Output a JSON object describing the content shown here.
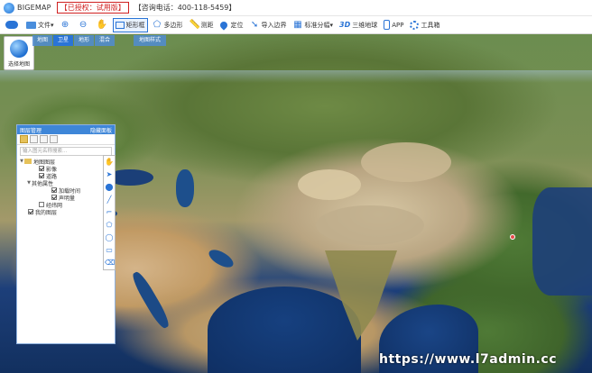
{
  "titlebar": {
    "app_name": "BIGEMAP",
    "license": "【已授权：试用版】",
    "phone": "【咨询电话：400-118-5459】"
  },
  "toolbar": {
    "items": [
      {
        "label": "文件",
        "icon": "folder-icon"
      },
      {
        "label": "",
        "icon": "zoom-in-icon"
      },
      {
        "label": "",
        "icon": "zoom-out-icon"
      },
      {
        "label": "",
        "icon": "hand-icon"
      },
      {
        "label": "矩形框",
        "icon": "rectangle-icon"
      },
      {
        "label": "多边形",
        "icon": "polygon-icon"
      },
      {
        "label": "测距",
        "icon": "ruler-icon"
      },
      {
        "label": "定位",
        "icon": "pin-icon"
      },
      {
        "label": "导入边界",
        "icon": "import-icon"
      },
      {
        "label": "标准分幅",
        "icon": "grid-icon"
      },
      {
        "label": "三维地球",
        "icon": "3d-icon"
      },
      {
        "label": "APP",
        "icon": "phone-icon"
      },
      {
        "label": "工具箱",
        "icon": "gear-icon"
      }
    ]
  },
  "left_control": {
    "label": "选择地图"
  },
  "layer_tabs": {
    "tabs": [
      "地图",
      "卫星",
      "地形",
      "混合"
    ],
    "active": "卫星",
    "style_label": "地图样式"
  },
  "layer_panel": {
    "title": "图层管理",
    "hide_label": "隐藏面板",
    "search_placeholder": "输入图元名称搜索...",
    "tree": {
      "root": "地图图层",
      "root_children": [
        "影像",
        "道路"
      ],
      "group": "其他属性",
      "group_children": [
        "加载时间",
        "声明量"
      ],
      "extra": "经纬网",
      "mine": "我的图层"
    }
  },
  "watermark": "https://www.l7admin.cc",
  "colors": {
    "accent": "#2a74d6",
    "license_red": "#d02020",
    "panel_header": "#3e86d8"
  }
}
